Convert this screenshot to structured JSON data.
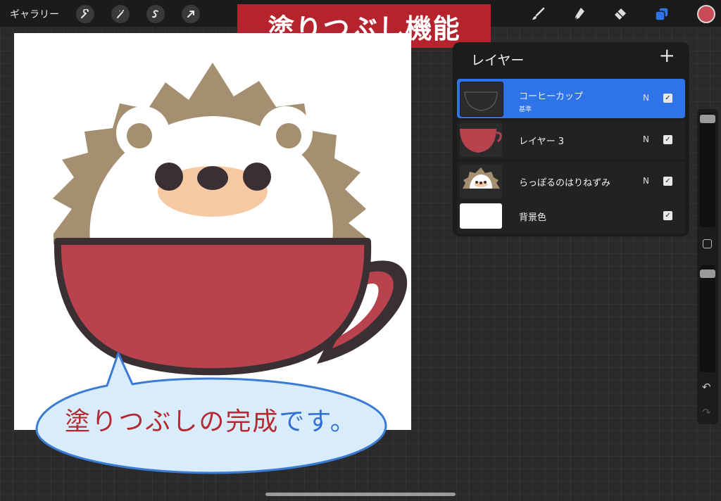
{
  "toolbar": {
    "gallery_label": "ギャラリー",
    "left_tools": [
      "wrench-icon",
      "magic-wand-icon",
      "selection-icon",
      "transform-arrow-icon"
    ],
    "right_tools": [
      "brush-icon",
      "smudge-icon",
      "eraser-icon",
      "layers-icon"
    ],
    "active_color": "#c84a56"
  },
  "banner": {
    "title": "塗りつぶし機能",
    "color": "#b5232c"
  },
  "layers_panel": {
    "title": "レイヤー",
    "add_label": "+",
    "layers": [
      {
        "name": "コーヒーカップ",
        "sublabel": "基準",
        "blend": "N",
        "visible": true,
        "active": true
      },
      {
        "name": "レイヤー 3",
        "blend": "N",
        "visible": true,
        "active": false
      },
      {
        "name": "らっぽるのはりねずみ",
        "blend": "N",
        "visible": true,
        "active": false
      },
      {
        "name": "背景色",
        "visible": true,
        "active": false
      }
    ],
    "checkmark": "✓"
  },
  "sidebar": {
    "undo": "↶",
    "redo": "↷"
  },
  "caption": {
    "main": "塗りつぶしの完成",
    "suffix": "です。"
  },
  "colors": {
    "cup_red": "#b8434e",
    "outline": "#3a3033",
    "hedgehog_spikes": "#a48f70",
    "cheeks": "#f6c9a2",
    "bubble_fill": "#d9ecfb",
    "bubble_stroke": "#3a7bd5"
  }
}
